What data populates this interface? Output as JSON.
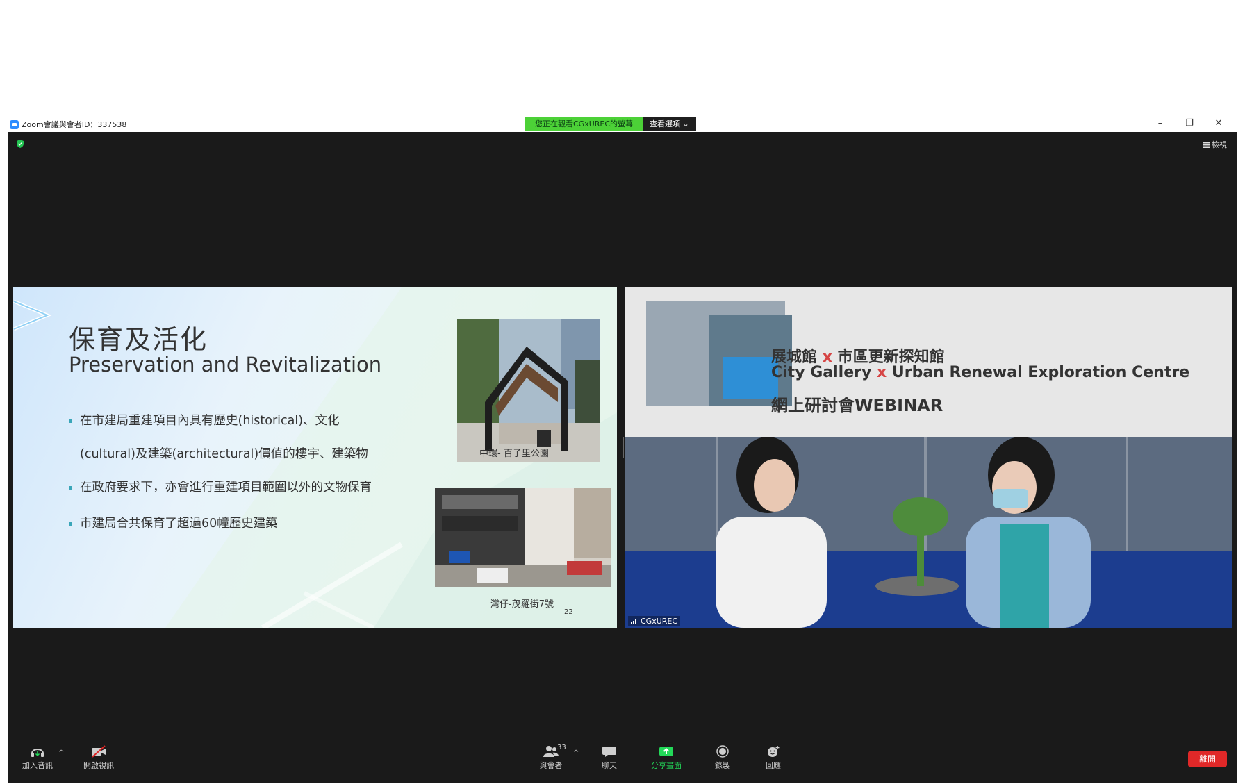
{
  "window": {
    "title": "Zoom會議與會者ID：337538",
    "controls": [
      "–",
      "❐",
      "✕"
    ]
  },
  "share_banner": {
    "status": "您正在觀看CGxUREC的螢幕",
    "view_options": "查看選項 ⌄"
  },
  "top_right": {
    "view_label": "檢視"
  },
  "slide": {
    "title_zh": "保育及活化",
    "title_en": "Preservation and Revitalization",
    "bullets": [
      "在市建局重建項目內具有歷史(historical)、文化",
      "(cultural)及建築(architectural)價值的樓宇、建築物",
      "在政府要求下，亦會進行重建項目範圍以外的文物保育",
      "市建局合共保育了超過60幢歷史建築"
    ],
    "photo1_caption": "中環- 百子里公園",
    "photo2_caption": "灣仔-茂羅街7號",
    "page_number": "22"
  },
  "video": {
    "banner_line1_a": "展城館",
    "banner_line1_x": "x",
    "banner_line1_b": "市區更新探知館",
    "banner_line2_a": "City Gallery",
    "banner_line2_x": "x",
    "banner_line2_b": "Urban Renewal Exploration Centre",
    "banner_line3": "網上研討會WEBINAR",
    "participant_name": "CGxUREC"
  },
  "toolbar": {
    "join_audio": "加入音訊",
    "start_video": "開啟視訊",
    "participants": "與會者",
    "participants_count": "33",
    "chat": "聊天",
    "share_screen": "分享畫面",
    "record": "錄製",
    "reactions": "回應",
    "leave": "離開"
  },
  "colors": {
    "stage_bg": "#1a1a1a",
    "share_green": "#4cd137",
    "leave_red": "#e02828",
    "share_icon_green": "#23d959"
  }
}
